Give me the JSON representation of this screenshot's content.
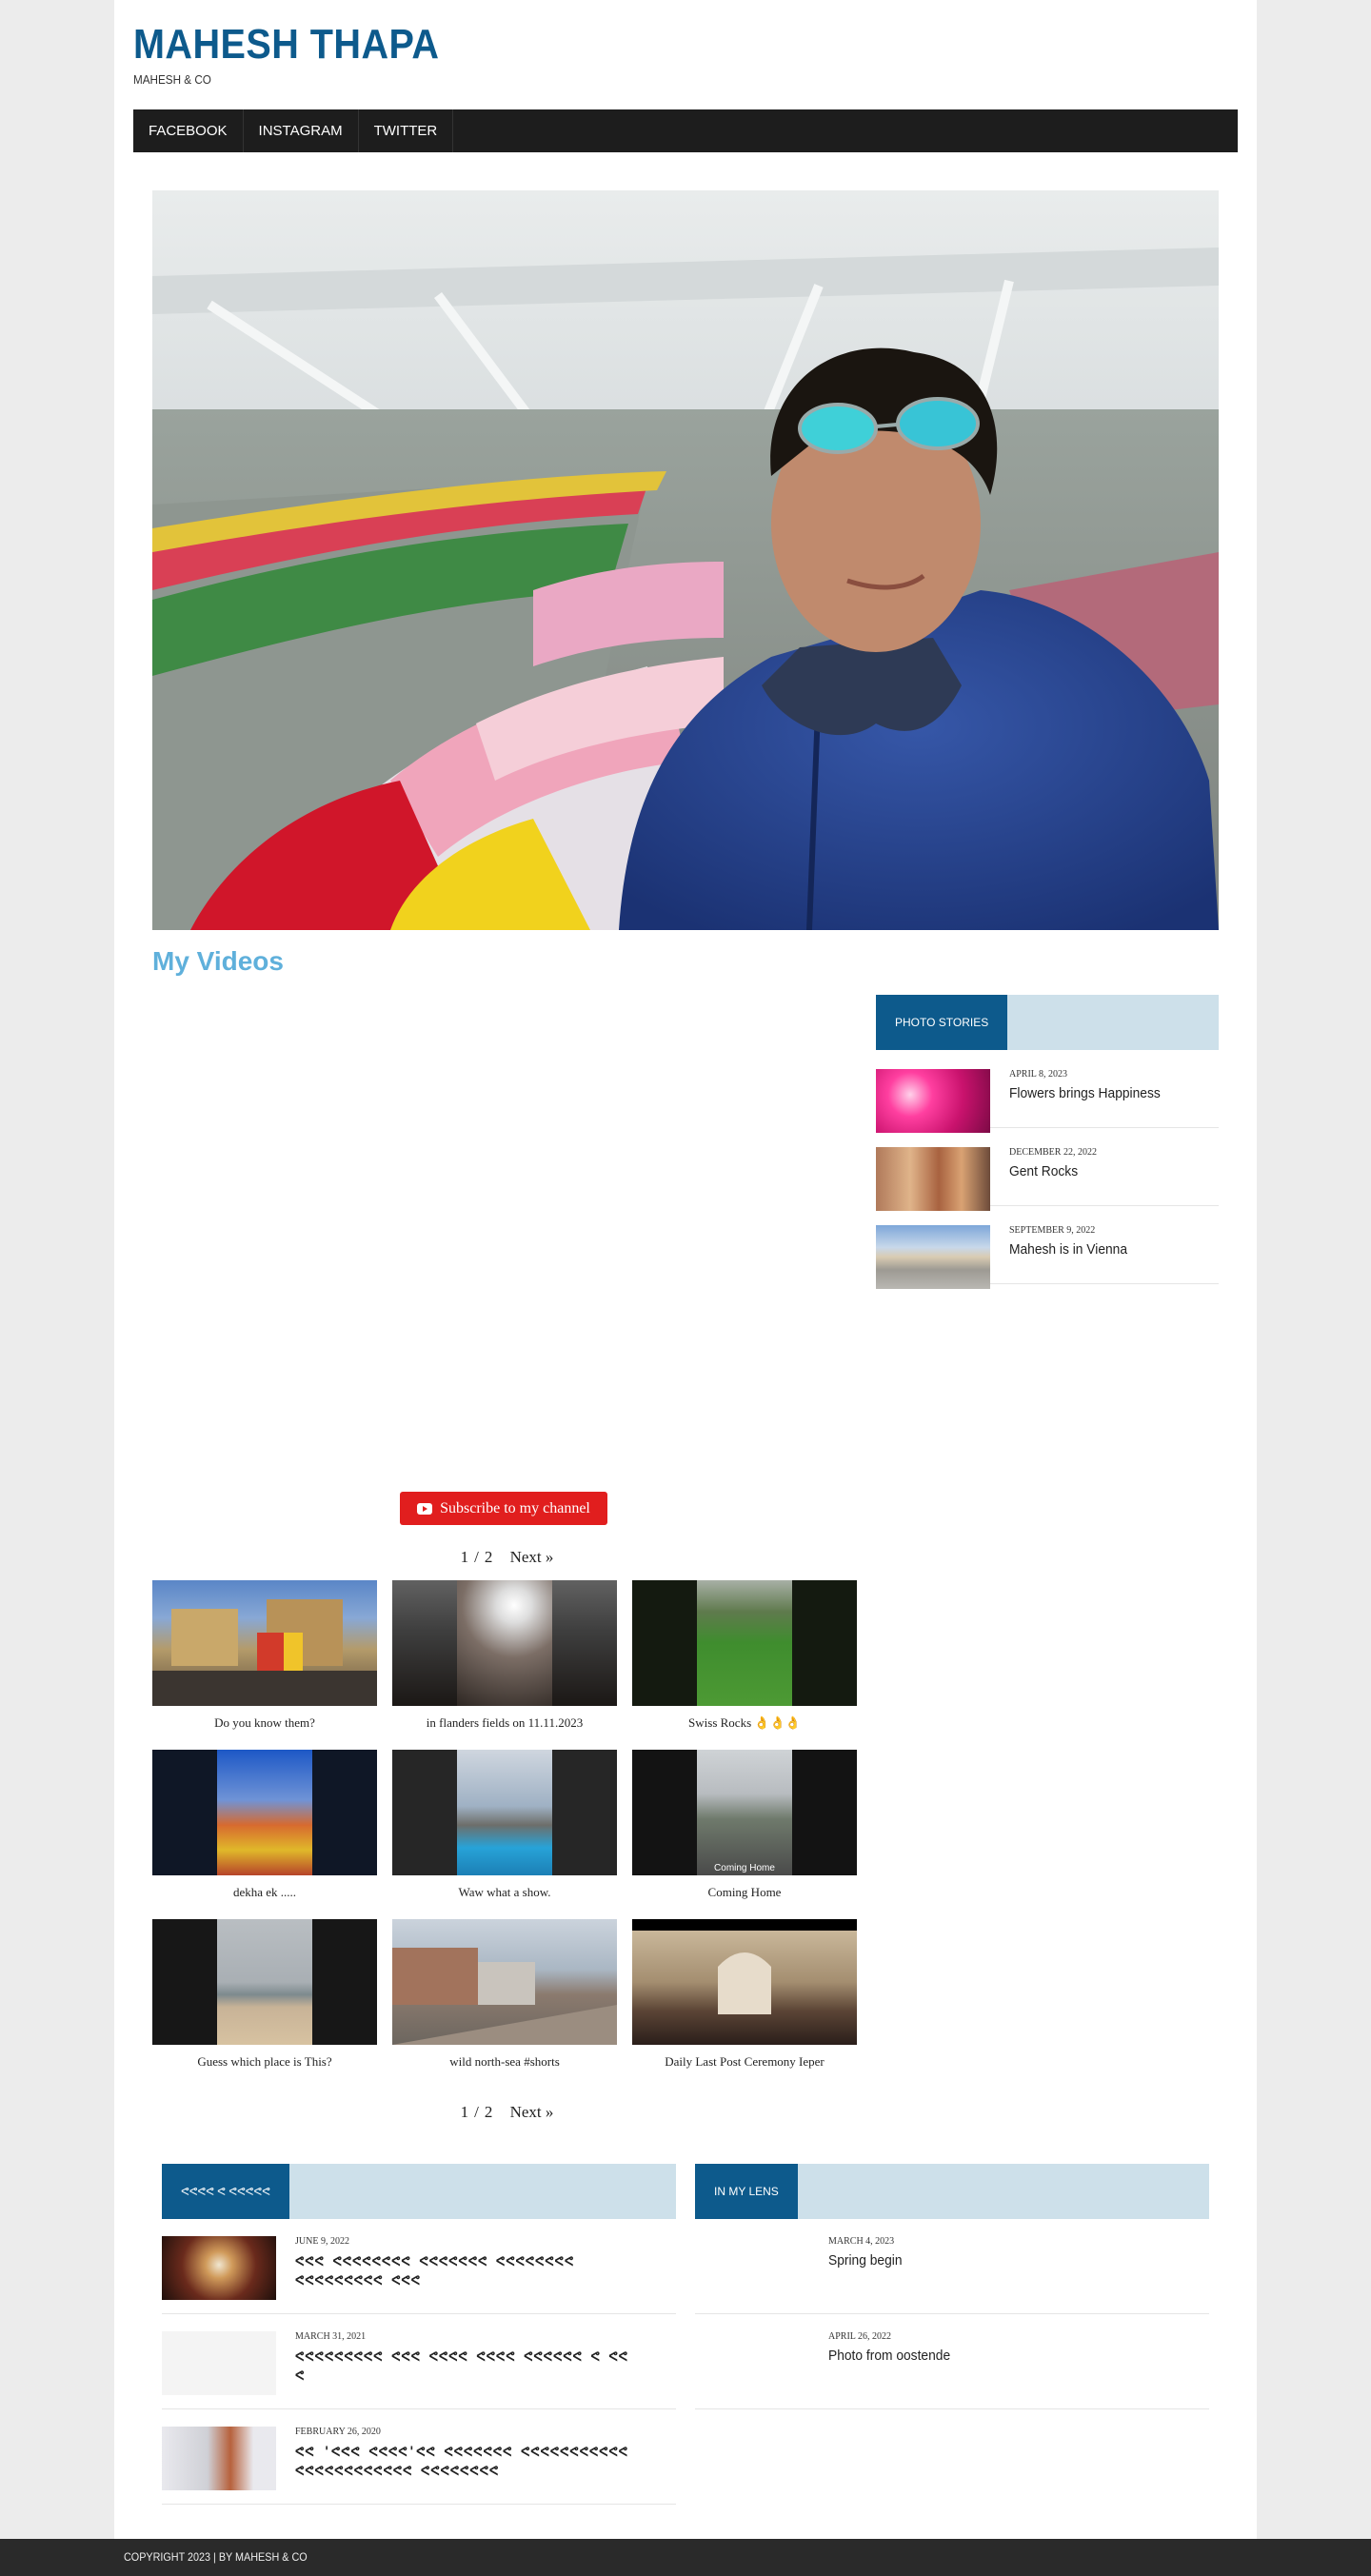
{
  "header": {
    "title": "MAHESH THAPA",
    "tagline": "MAHESH & CO"
  },
  "nav": {
    "items": [
      "FACEBOOK",
      "INSTAGRAM",
      "TWITTER"
    ]
  },
  "videos": {
    "title": "My Videos",
    "subscribe_label": "Subscribe to my channel",
    "page_current": "1",
    "page_sep": "/",
    "page_total": "2",
    "next_label": "Next »",
    "items": [
      {
        "caption": "Do you know them?"
      },
      {
        "caption": "in flanders fields on 11.11.2023"
      },
      {
        "caption": "Swiss Rocks 👌👌👌"
      },
      {
        "caption": "dekha ek ....."
      },
      {
        "caption": "Waw what a show."
      },
      {
        "caption": "Coming Home"
      },
      {
        "caption": "Guess which place is This?"
      },
      {
        "caption": "wild north-sea #shorts"
      },
      {
        "caption": "Daily Last Post Ceremony Ieper"
      }
    ],
    "thumb_overlay": "Coming Home"
  },
  "sidebar": {
    "widget_title": "PHOTO STORIES",
    "posts": [
      {
        "date": "APRIL 8, 2023",
        "title": "Flowers brings Happiness"
      },
      {
        "date": "DECEMBER 22, 2022",
        "title": "Gent Rocks"
      },
      {
        "date": "SEPTEMBER 9, 2022",
        "title": "Mahesh is in Vienna"
      }
    ]
  },
  "bottom_left": {
    "widget_title": "ᕙᕙᕙᕙ ᕙ ᕙᕙᕙᕙᕙ",
    "posts": [
      {
        "date": "JUNE 9, 2022",
        "title": "ᕙᕙᕙ ᕙᕙᕙᕙᕙᕙᕙᕙ ᕙᕙᕙᕙᕙᕙᕙ ᕙᕙᕙᕙᕙᕙᕙᕙ ᕙᕙᕙᕙᕙᕙᕙᕙᕙ ᕙᕙᕙ"
      },
      {
        "date": "MARCH 31, 2021",
        "title": "ᕙᕙᕙᕙᕙᕙᕙᕙᕙ ᕙᕙᕙ ᕙᕙᕙᕙ ᕙᕙᕙᕙ ᕙᕙᕙᕙᕙᕙ ᕙ ᕙᕙ ᕙ"
      },
      {
        "date": "FEBRUARY 26, 2020",
        "title": "ᕙᕙ 'ᕙᕙᕙ ᕙᕙᕙᕙ'ᕙᕙ ᕙᕙᕙᕙᕙᕙᕙ ᕙᕙᕙᕙᕙᕙᕙᕙᕙᕙᕙ ᕙᕙᕙᕙᕙᕙᕙᕙᕙᕙᕙᕙ ᕙᕙᕙᕙᕙᕙᕙᕙ"
      }
    ]
  },
  "bottom_right": {
    "widget_title": "IN MY LENS",
    "posts": [
      {
        "date": "MARCH 4, 2023",
        "title": "Spring begin"
      },
      {
        "date": "APRIL 26, 2022",
        "title": "Photo from oostende"
      }
    ]
  },
  "footer": {
    "text": "COPYRIGHT 2023 | BY MAHESH & CO"
  },
  "colors": {
    "brand": "#0d5a8c",
    "widget_bar": "#cde0ea",
    "videos_title": "#5fb0db",
    "subscribe": "#e11e1e"
  }
}
